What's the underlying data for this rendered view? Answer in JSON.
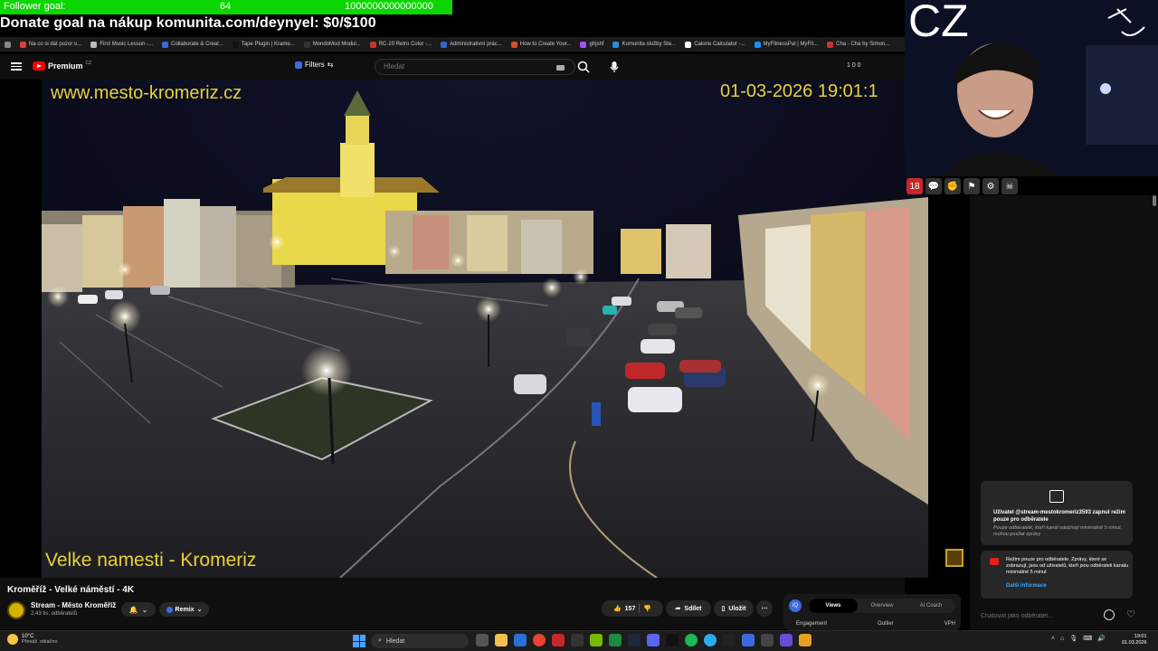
{
  "overlay": {
    "follower_label": "Follower goal:",
    "follower_count": "64",
    "follower_goal": "1000000000000000",
    "donate_text": "Donate goal na nákup komunita.com/deynyel: $0/$100",
    "country": "CZ"
  },
  "bookmarks": [
    {
      "label": "Na co si dát pozor u...",
      "color": "#e23b3b"
    },
    {
      "label": "First Music Lesson -...",
      "color": "#bbbbbb"
    },
    {
      "label": "Collaborate & Creat...",
      "color": "#3d6ae0"
    },
    {
      "label": "Tape Plugin | Krame...",
      "color": "#111111"
    },
    {
      "label": "MondoMod Modul...",
      "color": "#333333"
    },
    {
      "label": "RC-20 Retro Color -...",
      "color": "#cc3333"
    },
    {
      "label": "Administrativní prác...",
      "color": "#3366cc"
    },
    {
      "label": "How to Create Your...",
      "color": "#d94a2a"
    },
    {
      "label": "ghjshf",
      "color": "#a64dff"
    },
    {
      "label": "Komunita služby Ste...",
      "color": "#2a8fd6"
    },
    {
      "label": "Calorie Calculator -...",
      "color": "#ffffff"
    },
    {
      "label": "MyFitnessPal | MyFit...",
      "color": "#1a8cff"
    },
    {
      "label": "Cha - Cha by Simon...",
      "color": "#cc3333"
    }
  ],
  "youtube": {
    "logo_text": "Premium",
    "region": "CZ",
    "filters_label": "Filters",
    "search_placeholder": "Hledat",
    "header_right": "1 0 0"
  },
  "video": {
    "cam_url": "www.mesto-kromeriz.cz",
    "cam_timestamp": "01-03-2026 19:01:1",
    "cam_caption": "Velke namesti - Kromeriz",
    "title": "Kroměříž - Velké náměstí - 4K",
    "channel_name": "Stream - Město Kroměříž",
    "channel_subs": "2,43 tis. odběratelů",
    "remix_label": "Remix",
    "like_count": "157",
    "share_label": "Sdílet",
    "save_label": "Uložit"
  },
  "insights": {
    "tabs": [
      "Views",
      "Overview",
      "AI Coach"
    ],
    "columns": [
      "Engagement",
      "Outlier",
      "VPH"
    ]
  },
  "chat": {
    "subs_title": "Uživatel @stream-mestokromeriz3593 zapnul režim pouze pro odběratele",
    "subs_desc": "Pouze odběratelé, kteří kanál odebírají minimálně 5 minut, mohou posílat zprávy",
    "mode_text": "Režim pouze pro odběratele. Zprávy, které se zobrazují, jsou od uživatelů, kteří jsou odběrateli kanálu minimálně 5 minut",
    "mode_link": "Další informace",
    "input_placeholder": "Chatovat jako odběratel..."
  },
  "taskbar": {
    "weather_temp": "10°C",
    "weather_desc": "Převáž. oblačno",
    "search_label": "Hledat",
    "clock_time": "19:01",
    "clock_date": "01.03.2026"
  }
}
